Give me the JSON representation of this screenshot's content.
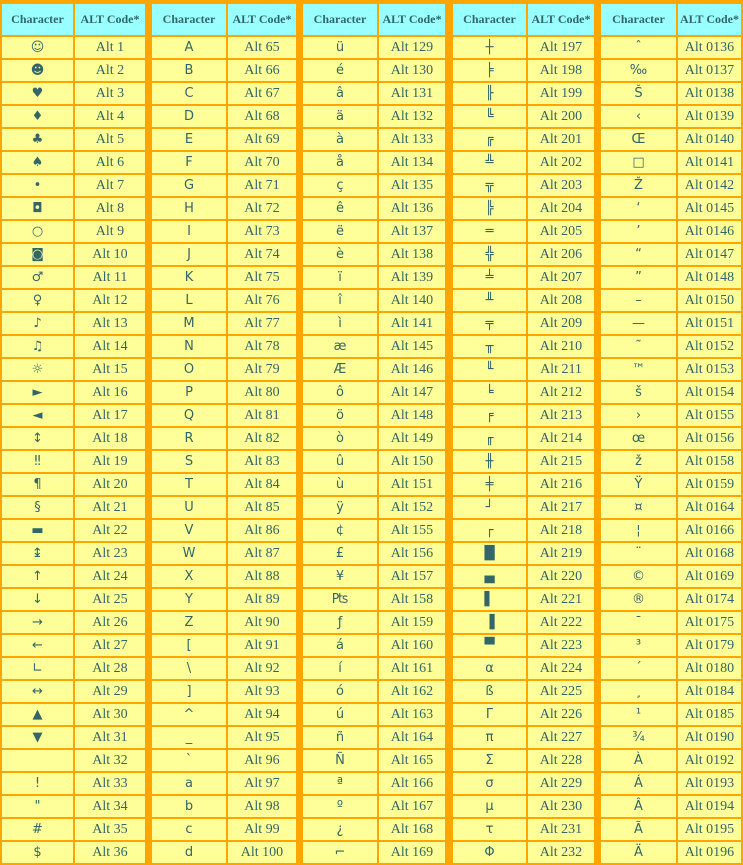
{
  "header": {
    "character": "Character",
    "alt_code": "ALT Code*"
  },
  "colors": {
    "background": "#FFA500",
    "header_bg": "#99FFFF",
    "cell_bg": "#FFFF99",
    "text": "#336666"
  },
  "tables": [
    {
      "rows": [
        {
          "char": "☺",
          "code": "Alt 1"
        },
        {
          "char": "☻",
          "code": "Alt 2"
        },
        {
          "char": "♥",
          "code": "Alt 3"
        },
        {
          "char": "♦",
          "code": "Alt 4"
        },
        {
          "char": "♣",
          "code": "Alt 5"
        },
        {
          "char": "♠",
          "code": "Alt 6"
        },
        {
          "char": "•",
          "code": "Alt 7"
        },
        {
          "char": "◘",
          "code": "Alt 8"
        },
        {
          "char": "○",
          "code": "Alt 9"
        },
        {
          "char": "◙",
          "code": "Alt 10"
        },
        {
          "char": "♂",
          "code": "Alt 11"
        },
        {
          "char": "♀",
          "code": "Alt 12"
        },
        {
          "char": "♪",
          "code": "Alt 13"
        },
        {
          "char": "♫",
          "code": "Alt 14"
        },
        {
          "char": "☼",
          "code": "Alt 15"
        },
        {
          "char": "►",
          "code": "Alt 16"
        },
        {
          "char": "◄",
          "code": "Alt 17"
        },
        {
          "char": "↕",
          "code": "Alt 18"
        },
        {
          "char": "‼",
          "code": "Alt 19"
        },
        {
          "char": "¶",
          "code": "Alt 20"
        },
        {
          "char": "§",
          "code": "Alt 21"
        },
        {
          "char": "▬",
          "code": "Alt 22"
        },
        {
          "char": "↨",
          "code": "Alt 23"
        },
        {
          "char": "↑",
          "code": "Alt 24"
        },
        {
          "char": "↓",
          "code": "Alt 25"
        },
        {
          "char": "→",
          "code": "Alt 26"
        },
        {
          "char": "←",
          "code": "Alt 27"
        },
        {
          "char": "∟",
          "code": "Alt 28"
        },
        {
          "char": "↔",
          "code": "Alt 29"
        },
        {
          "char": "▲",
          "code": "Alt 30"
        },
        {
          "char": "▼",
          "code": "Alt 31"
        },
        {
          "char": "",
          "code": "Alt 32"
        },
        {
          "char": "!",
          "code": "Alt 33"
        },
        {
          "char": "\"",
          "code": "Alt 34"
        },
        {
          "char": "#",
          "code": "Alt 35"
        },
        {
          "char": "$",
          "code": "Alt 36"
        }
      ]
    },
    {
      "rows": [
        {
          "char": "A",
          "code": "Alt 65"
        },
        {
          "char": "B",
          "code": "Alt 66"
        },
        {
          "char": "C",
          "code": "Alt 67"
        },
        {
          "char": "D",
          "code": "Alt 68"
        },
        {
          "char": "E",
          "code": "Alt 69"
        },
        {
          "char": "F",
          "code": "Alt 70"
        },
        {
          "char": "G",
          "code": "Alt 71"
        },
        {
          "char": "H",
          "code": "Alt 72"
        },
        {
          "char": "I",
          "code": "Alt 73"
        },
        {
          "char": "J",
          "code": "Alt 74"
        },
        {
          "char": "K",
          "code": "Alt 75"
        },
        {
          "char": "L",
          "code": "Alt 76"
        },
        {
          "char": "M",
          "code": "Alt 77"
        },
        {
          "char": "N",
          "code": "Alt 78"
        },
        {
          "char": "O",
          "code": "Alt 79"
        },
        {
          "char": "P",
          "code": "Alt 80"
        },
        {
          "char": "Q",
          "code": "Alt 81"
        },
        {
          "char": "R",
          "code": "Alt 82"
        },
        {
          "char": "S",
          "code": "Alt 83"
        },
        {
          "char": "T",
          "code": "Alt 84"
        },
        {
          "char": "U",
          "code": "Alt 85"
        },
        {
          "char": "V",
          "code": "Alt 86"
        },
        {
          "char": "W",
          "code": "Alt 87"
        },
        {
          "char": "X",
          "code": "Alt 88"
        },
        {
          "char": "Y",
          "code": "Alt 89"
        },
        {
          "char": "Z",
          "code": "Alt 90"
        },
        {
          "char": "[",
          "code": "Alt 91"
        },
        {
          "char": "\\",
          "code": "Alt 92"
        },
        {
          "char": "]",
          "code": "Alt 93"
        },
        {
          "char": "^",
          "code": "Alt 94"
        },
        {
          "char": "_",
          "code": "Alt 95"
        },
        {
          "char": "`",
          "code": "Alt 96"
        },
        {
          "char": "a",
          "code": "Alt 97"
        },
        {
          "char": "b",
          "code": "Alt 98"
        },
        {
          "char": "c",
          "code": "Alt 99"
        },
        {
          "char": "d",
          "code": "Alt 100"
        }
      ]
    },
    {
      "rows": [
        {
          "char": "ü",
          "code": "Alt 129"
        },
        {
          "char": "é",
          "code": "Alt 130"
        },
        {
          "char": "â",
          "code": "Alt 131"
        },
        {
          "char": "ä",
          "code": "Alt 132"
        },
        {
          "char": "à",
          "code": "Alt 133"
        },
        {
          "char": "å",
          "code": "Alt 134"
        },
        {
          "char": "ç",
          "code": "Alt 135"
        },
        {
          "char": "ê",
          "code": "Alt 136"
        },
        {
          "char": "ë",
          "code": "Alt 137"
        },
        {
          "char": "è",
          "code": "Alt 138"
        },
        {
          "char": "ï",
          "code": "Alt 139"
        },
        {
          "char": "î",
          "code": "Alt 140"
        },
        {
          "char": "ì",
          "code": "Alt 141"
        },
        {
          "char": "æ",
          "code": "Alt 145"
        },
        {
          "char": "Æ",
          "code": "Alt 146"
        },
        {
          "char": "ô",
          "code": "Alt 147"
        },
        {
          "char": "ö",
          "code": "Alt 148"
        },
        {
          "char": "ò",
          "code": "Alt 149"
        },
        {
          "char": "û",
          "code": "Alt 150"
        },
        {
          "char": "ù",
          "code": "Alt 151"
        },
        {
          "char": "ÿ",
          "code": "Alt 152"
        },
        {
          "char": "¢",
          "code": "Alt 155"
        },
        {
          "char": "£",
          "code": "Alt 156"
        },
        {
          "char": "¥",
          "code": "Alt 157"
        },
        {
          "char": "₧",
          "code": "Alt 158"
        },
        {
          "char": "ƒ",
          "code": "Alt 159"
        },
        {
          "char": "á",
          "code": "Alt 160"
        },
        {
          "char": "í",
          "code": "Alt 161"
        },
        {
          "char": "ó",
          "code": "Alt 162"
        },
        {
          "char": "ú",
          "code": "Alt 163"
        },
        {
          "char": "ñ",
          "code": "Alt 164"
        },
        {
          "char": "Ñ",
          "code": "Alt 165"
        },
        {
          "char": "ª",
          "code": "Alt 166"
        },
        {
          "char": "º",
          "code": "Alt 167"
        },
        {
          "char": "¿",
          "code": "Alt 168"
        },
        {
          "char": "⌐",
          "code": "Alt 169"
        }
      ]
    },
    {
      "rows": [
        {
          "char": "┼",
          "code": "Alt 197"
        },
        {
          "char": "╞",
          "code": "Alt 198"
        },
        {
          "char": "╟",
          "code": "Alt 199"
        },
        {
          "char": "╚",
          "code": "Alt 200"
        },
        {
          "char": "╔",
          "code": "Alt 201"
        },
        {
          "char": "╩",
          "code": "Alt 202"
        },
        {
          "char": "╦",
          "code": "Alt 203"
        },
        {
          "char": "╠",
          "code": "Alt 204"
        },
        {
          "char": "═",
          "code": "Alt 205"
        },
        {
          "char": "╬",
          "code": "Alt 206"
        },
        {
          "char": "╧",
          "code": "Alt 207"
        },
        {
          "char": "╨",
          "code": "Alt 208"
        },
        {
          "char": "╤",
          "code": "Alt 209"
        },
        {
          "char": "╥",
          "code": "Alt 210"
        },
        {
          "char": "╙",
          "code": "Alt 211"
        },
        {
          "char": "╘",
          "code": "Alt 212"
        },
        {
          "char": "╒",
          "code": "Alt 213"
        },
        {
          "char": "╓",
          "code": "Alt 214"
        },
        {
          "char": "╫",
          "code": "Alt 215"
        },
        {
          "char": "╪",
          "code": "Alt 216"
        },
        {
          "char": "┘",
          "code": "Alt 217"
        },
        {
          "char": "┌",
          "code": "Alt 218"
        },
        {
          "char": "█",
          "code": "Alt 219"
        },
        {
          "char": "▄",
          "code": "Alt 220"
        },
        {
          "char": "▌",
          "code": "Alt 221"
        },
        {
          "char": "▐",
          "code": "Alt 222"
        },
        {
          "char": "▀",
          "code": "Alt 223"
        },
        {
          "char": "α",
          "code": "Alt 224"
        },
        {
          "char": "ß",
          "code": "Alt 225"
        },
        {
          "char": "Γ",
          "code": "Alt 226"
        },
        {
          "char": "π",
          "code": "Alt 227"
        },
        {
          "char": "Σ",
          "code": "Alt 228"
        },
        {
          "char": "σ",
          "code": "Alt 229"
        },
        {
          "char": "µ",
          "code": "Alt 230"
        },
        {
          "char": "τ",
          "code": "Alt 231"
        },
        {
          "char": "Φ",
          "code": "Alt 232"
        }
      ]
    },
    {
      "rows": [
        {
          "char": "ˆ",
          "code": "Alt 0136"
        },
        {
          "char": "‰",
          "code": "Alt 0137"
        },
        {
          "char": "Š",
          "code": "Alt 0138"
        },
        {
          "char": "‹",
          "code": "Alt 0139"
        },
        {
          "char": "Œ",
          "code": "Alt 0140"
        },
        {
          "char": "□",
          "code": "Alt 0141"
        },
        {
          "char": "Ž",
          "code": "Alt 0142"
        },
        {
          "char": "‘",
          "code": "Alt 0145"
        },
        {
          "char": "’",
          "code": "Alt 0146"
        },
        {
          "char": "“",
          "code": "Alt 0147"
        },
        {
          "char": "”",
          "code": "Alt 0148"
        },
        {
          "char": "–",
          "code": "Alt 0150"
        },
        {
          "char": "—",
          "code": "Alt 0151"
        },
        {
          "char": "˜",
          "code": "Alt 0152"
        },
        {
          "char": "™",
          "code": "Alt 0153"
        },
        {
          "char": "š",
          "code": "Alt 0154"
        },
        {
          "char": "›",
          "code": "Alt 0155"
        },
        {
          "char": "œ",
          "code": "Alt 0156"
        },
        {
          "char": "ž",
          "code": "Alt 0158"
        },
        {
          "char": "Ÿ",
          "code": "Alt 0159"
        },
        {
          "char": "¤",
          "code": "Alt 0164"
        },
        {
          "char": "¦",
          "code": "Alt 0166"
        },
        {
          "char": "¨",
          "code": "Alt 0168"
        },
        {
          "char": "©",
          "code": "Alt 0169"
        },
        {
          "char": "®",
          "code": "Alt 0174"
        },
        {
          "char": "¯",
          "code": "Alt 0175"
        },
        {
          "char": "³",
          "code": "Alt 0179"
        },
        {
          "char": "´",
          "code": "Alt 0180"
        },
        {
          "char": "¸",
          "code": "Alt 0184"
        },
        {
          "char": "¹",
          "code": "Alt 0185"
        },
        {
          "char": "¾",
          "code": "Alt 0190"
        },
        {
          "char": "À",
          "code": "Alt 0192"
        },
        {
          "char": "Á",
          "code": "Alt 0193"
        },
        {
          "char": "Â",
          "code": "Alt 0194"
        },
        {
          "char": "Ã",
          "code": "Alt 0195"
        },
        {
          "char": "Ä",
          "code": "Alt 0196"
        }
      ]
    }
  ]
}
